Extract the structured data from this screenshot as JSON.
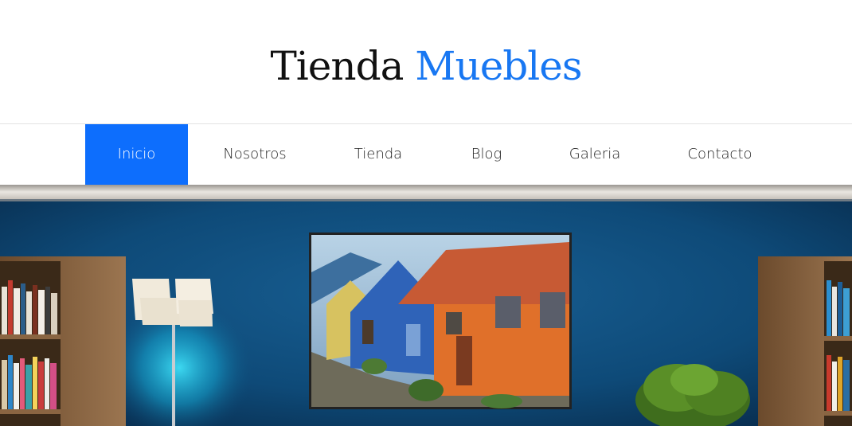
{
  "brand": {
    "word1": "Tienda",
    "word2": "Muebles"
  },
  "nav": {
    "items": [
      {
        "label": "Inicio",
        "active": true
      },
      {
        "label": "Nosotros",
        "active": false
      },
      {
        "label": "Tienda",
        "active": false
      },
      {
        "label": "Blog",
        "active": false
      },
      {
        "label": "Galeria",
        "active": false
      },
      {
        "label": "Contacto",
        "active": false
      }
    ]
  },
  "colors": {
    "accent": "#0d6efd",
    "brand_blue": "#1877f2",
    "wall": "#0e4a78"
  },
  "hero": {
    "icons": [
      "bookshelf",
      "floor-lamp",
      "painting-colorful-houses",
      "potted-plant"
    ]
  }
}
